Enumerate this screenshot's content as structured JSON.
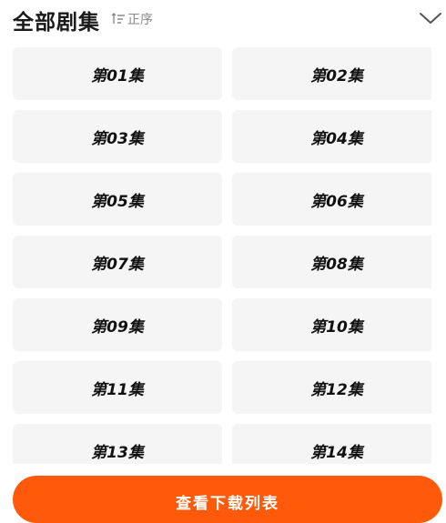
{
  "header": {
    "title": "全部剧集",
    "sort_label": "正序"
  },
  "icons": {
    "sort": "sort-ascending-icon",
    "collapse": "chevron-down-icon"
  },
  "colors": {
    "accent": "#ff5a0a",
    "tile_bg": "#f5f5f5",
    "title_text": "#1a1a1a",
    "sort_text": "#8a8a8a"
  },
  "episodes": [
    {
      "label": "第01集"
    },
    {
      "label": "第02集"
    },
    {
      "label": "第03集"
    },
    {
      "label": "第04集"
    },
    {
      "label": "第05集"
    },
    {
      "label": "第06集"
    },
    {
      "label": "第07集"
    },
    {
      "label": "第08集"
    },
    {
      "label": "第09集"
    },
    {
      "label": "第10集"
    },
    {
      "label": "第11集"
    },
    {
      "label": "第12集"
    },
    {
      "label": "第13集"
    },
    {
      "label": "第14集"
    }
  ],
  "footer": {
    "download_label": "查看下载列表"
  }
}
